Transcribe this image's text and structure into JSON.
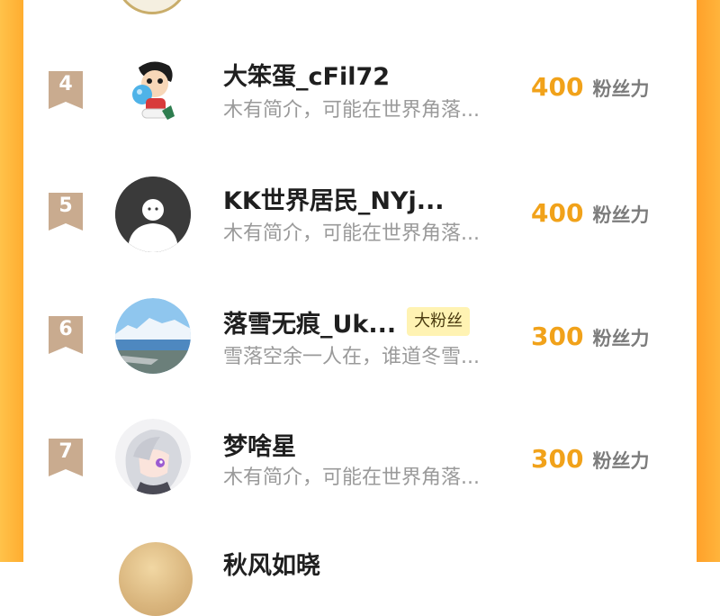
{
  "colors": {
    "frame": "#ffad30",
    "badge": "#c9ab8f",
    "fan_count": "#f1a21a",
    "fan_tag_bg": "#fff3b3"
  },
  "rows": [
    {
      "rank": "4",
      "name": "大笨蛋_cFil72",
      "bio": "木有简介，可能在世界角落...",
      "fans": "400",
      "fans_unit": "粉丝力",
      "avatar_icon": "cartoon-boy-avatar"
    },
    {
      "rank": "5",
      "name": "KK世界居民_NYj...",
      "bio": "木有简介，可能在世界角落...",
      "fans": "400",
      "fans_unit": "粉丝力",
      "avatar_icon": "default-person-avatar"
    },
    {
      "rank": "6",
      "name": "落雪无痕_Uk...",
      "tag": "大粉丝",
      "bio": "雪落空余一人在，谁道冬雪...",
      "fans": "300",
      "fans_unit": "粉丝力",
      "avatar_icon": "snow-mountain-lake-avatar"
    },
    {
      "rank": "7",
      "name": "梦啥星",
      "bio": "木有简介，可能在世界角落...",
      "fans": "300",
      "fans_unit": "粉丝力",
      "avatar_icon": "anime-girl-avatar"
    }
  ],
  "next_row_partial_name": "秋风如晓"
}
